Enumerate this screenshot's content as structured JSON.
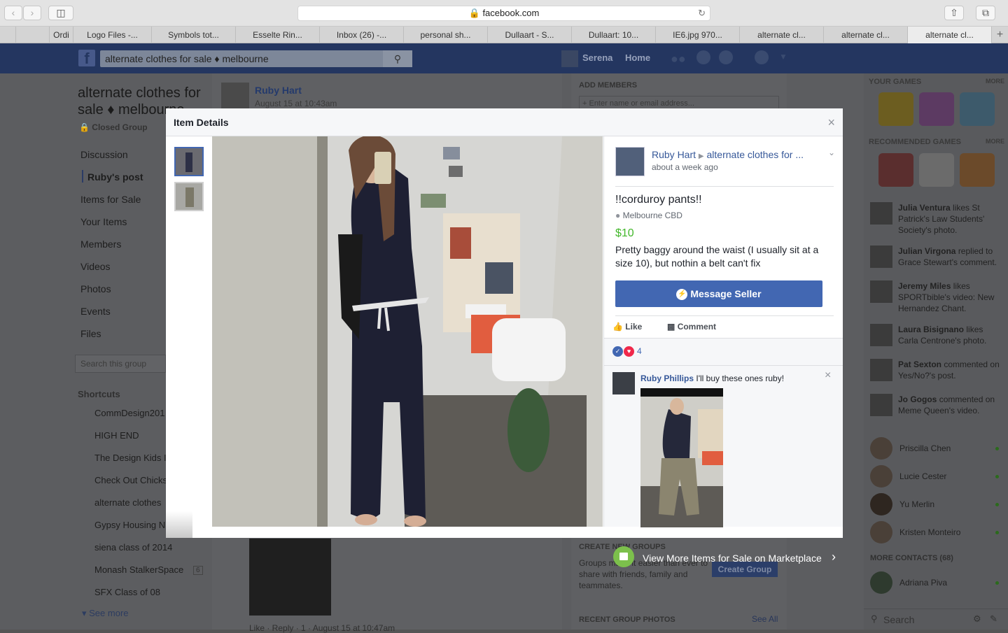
{
  "browser": {
    "url": "facebook.com",
    "tabs": [
      "Ordi",
      "Logo Files -...",
      "Symbols tot...",
      "Esselte Rin...",
      "Inbox (26) -...",
      "personal sh...",
      "Dullaart - S...",
      "Dullaart: 10...",
      "IE6.jpg 970...",
      "alternate cl...",
      "alternate cl...",
      "alternate cl..."
    ],
    "active_tab_index": 11
  },
  "fb_header": {
    "logo": "f",
    "search_value": "alternate clothes for sale ♦ melbourne",
    "user_name": "Serena",
    "home_label": "Home"
  },
  "group": {
    "title_line1": "alternate clothes for",
    "title_line2": "sale ♦ melbourne",
    "privacy": "Closed Group",
    "nav": [
      "Discussion",
      "Ruby's post",
      "Items for Sale",
      "Your Items",
      "Members",
      "Videos",
      "Photos",
      "Events",
      "Files"
    ],
    "search_placeholder": "Search this group",
    "shortcuts_heading": "Shortcuts",
    "shortcuts": [
      "CommDesign201",
      "HIGH END",
      "The Design Kids I",
      "Check Out Chicks",
      "alternate clothes",
      "Gypsy Housing N",
      "siena class of 2014",
      "Monash StalkerSpace",
      "SFX Class of 08"
    ],
    "shortcut_badge": "6",
    "see_more": "See more"
  },
  "feed": {
    "post_author": "Ruby Hart",
    "post_time": "August 15 at 10:43am",
    "comment_actions": "Like · Reply · 1 · August 15 at 10:47am"
  },
  "middle_right": {
    "add_members_heading": "ADD MEMBERS",
    "add_members_placeholder": "+ Enter name or email address...",
    "create_groups_heading": "CREATE NEW GROUPS",
    "create_groups_text": "Groups make it easier than ever to share with friends, family and teammates.",
    "create_group_button": "Create Group",
    "recent_photos_heading": "RECENT GROUP PHOTOS",
    "see_all": "See All"
  },
  "right_rail": {
    "your_games": "YOUR GAMES",
    "more": "MORE",
    "recommended_games": "RECOMMENDED GAMES",
    "activity": [
      {
        "name": "Julia Ventura",
        "text": "likes St Patrick's Law Students' Society's photo."
      },
      {
        "name": "Julian Virgona",
        "text": "replied to Grace Stewart's comment."
      },
      {
        "name": "Jeremy Miles",
        "text": "likes SPORTbible's video: New Hernandez Chant."
      },
      {
        "name": "Laura Bisignano",
        "text": "likes Carla Centrone's photo."
      },
      {
        "name": "Pat Sexton",
        "text": "commented on Yes/No?'s post."
      },
      {
        "name": "Jo Gogos",
        "text": "commented on Meme Queen's video."
      }
    ],
    "contacts": [
      "Priscilla Chen",
      "Lucie Cester",
      "Yu Merlin",
      "Kristen Monteiro"
    ],
    "more_contacts": "MORE CONTACTS (68)",
    "more_contacts_list": [
      "Adriana Piva"
    ],
    "search_placeholder": "Search"
  },
  "modal": {
    "title": "Item Details",
    "seller": "Ruby Hart",
    "group": "alternate clothes for ...",
    "time": "about a week ago",
    "item_title": "!!corduroy pants!!",
    "location": "Melbourne CBD",
    "price": "$10",
    "description": "Pretty baggy around the waist (I usually sit at a size 10), but nothin a belt can't fix",
    "message_button": "Message Seller",
    "like_label": "Like",
    "comment_label": "Comment",
    "reaction_count": "4",
    "comment_author": "Ruby Phillips",
    "comment_text": "I'll buy these ones ruby!",
    "close_glyph": "×"
  },
  "marketplace": {
    "label": "View More Items for Sale on Marketplace"
  },
  "colors": {
    "fb_blue": "#4267b2",
    "link_blue": "#365899",
    "price_green": "#42b72a",
    "header_navy": "#243660"
  }
}
